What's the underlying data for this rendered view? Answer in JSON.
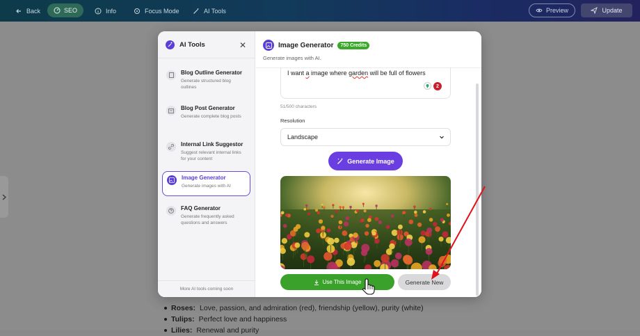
{
  "topbar": {
    "back_label": "Back",
    "seo_label": "SEO",
    "info_label": "Info",
    "focus_label": "Focus Mode",
    "ai_tools_label": "AI Tools",
    "preview_label": "Preview",
    "update_label": "Update"
  },
  "background_list": [
    {
      "term": "Roses:",
      "text": "Love, passion, and admiration (red), friendship (yellow), purity (white)"
    },
    {
      "term": "Tulips:",
      "text": "Perfect love and happiness"
    },
    {
      "term": "Lilies:",
      "text": "Renewal and purity"
    }
  ],
  "sidebar": {
    "title": "AI Tools",
    "footer": "More AI tools coming soon",
    "tools": [
      {
        "name": "Blog Outline Generator",
        "desc": "Generate structured blog outlines",
        "icon": "document-icon"
      },
      {
        "name": "Blog Post Generator",
        "desc": "Generate complete blog posts",
        "icon": "article-icon"
      },
      {
        "name": "Internal Link Suggestor",
        "desc": "Suggest relevant internal links for your content",
        "icon": "link-icon"
      },
      {
        "name": "Image Generator",
        "desc": "Generate images with AI",
        "icon": "image-icon"
      },
      {
        "name": "FAQ Generator",
        "desc": "Generate frequently asked questions and answers",
        "icon": "question-icon"
      }
    ]
  },
  "panel": {
    "title": "Image Generator",
    "credits": "750 Credits",
    "subtitle": "Generate images with AI.",
    "prompt_text_parts": [
      "I want ",
      "a",
      " image where ",
      "garden",
      " will be full of flowers"
    ],
    "extension_badge": "2",
    "char_count": "51/500 characters",
    "resolution_label": "Resolution",
    "resolution_value": "Landscape",
    "generate_label": "Generate Image",
    "use_label": "Use This Image",
    "new_label": "Generate New"
  },
  "colors": {
    "accent": "#6a3ee0",
    "credits_green": "#3aa829",
    "use_green": "#3aa12a",
    "annotation_red": "#e0121b"
  }
}
